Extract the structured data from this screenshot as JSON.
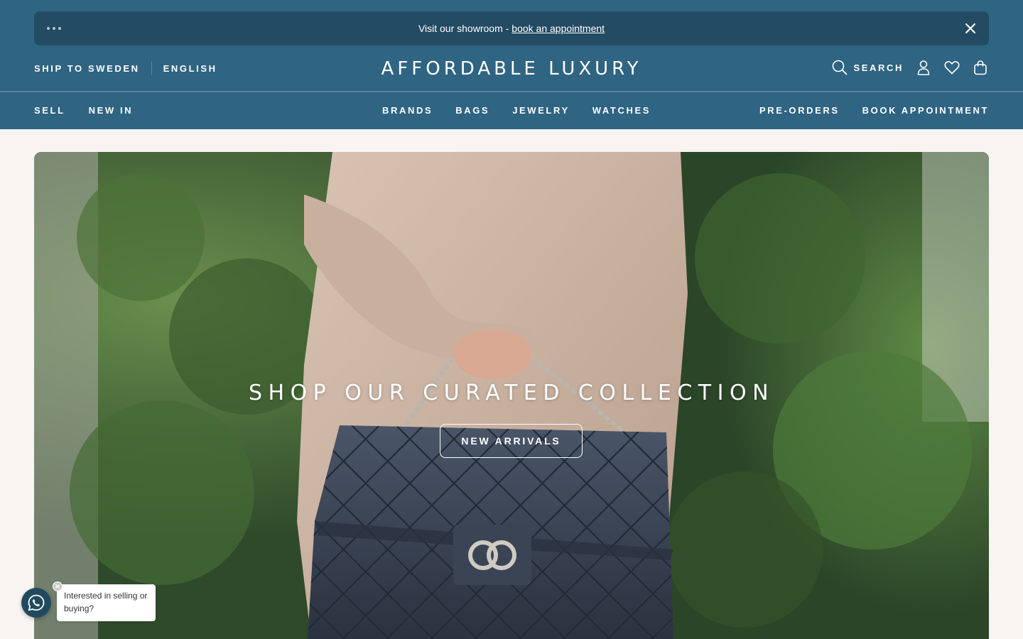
{
  "announcement": {
    "text": "Visit our showroom -",
    "link_label": "book an appointment"
  },
  "topbar": {
    "ship_to": "SHIP TO SWEDEN",
    "language": "ENGLISH",
    "logo": "AFFORDABLE LUXURY",
    "search_label": "SEARCH"
  },
  "nav": {
    "left": [
      "SELL",
      "NEW IN"
    ],
    "center": [
      "BRANDS",
      "BAGS",
      "JEWELRY",
      "WATCHES"
    ],
    "right": [
      "PRE-ORDERS",
      "BOOK APPOINTMENT"
    ]
  },
  "hero": {
    "headline": "SHOP OUR CURATED COLLECTION",
    "button_label": "NEW ARRIVALS"
  },
  "chat_widget": {
    "message": "Interested in selling or buying?"
  },
  "colors": {
    "header_bg": "#2f6482",
    "announcement_bg": "#234b63",
    "page_bg": "#f8f4f1"
  }
}
